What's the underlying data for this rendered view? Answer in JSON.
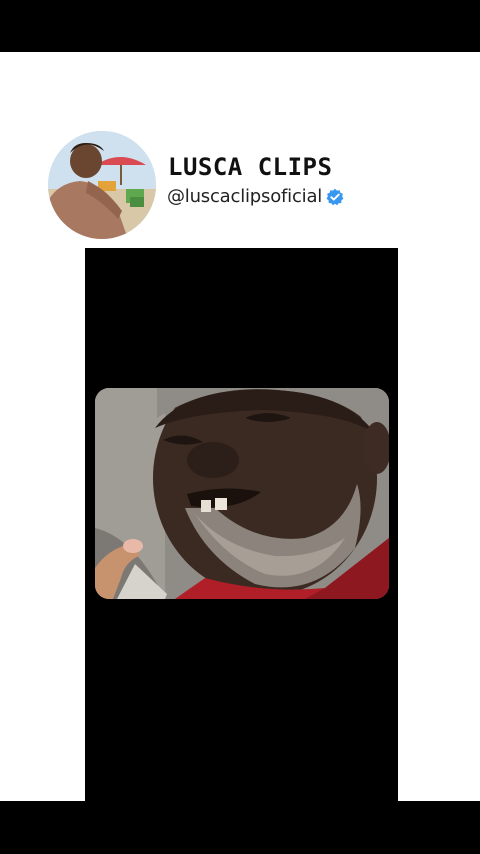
{
  "channel": {
    "name": "LUSCA CLIPS",
    "handle": "@luscaclipsoficial",
    "verified": true,
    "verified_badge_icon": "verified-check-icon",
    "verified_color": "#3897f0"
  },
  "avatar": {
    "icon": "profile-avatar-photo",
    "description_colors": [
      "#d9c7b0",
      "#d94a52",
      "#6fa35a"
    ]
  },
  "video": {
    "icon": "video-thumbnail-photo",
    "background": "#000000"
  }
}
